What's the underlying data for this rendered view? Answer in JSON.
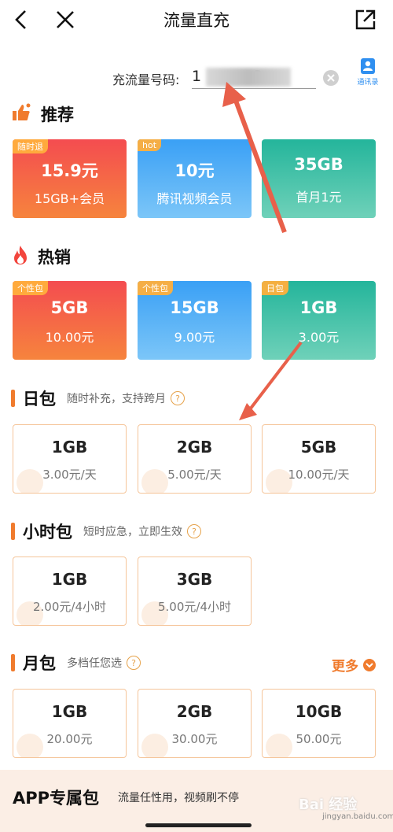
{
  "header": {
    "title": "流量直充"
  },
  "phone": {
    "label": "充流量号码:",
    "value": "1           3",
    "contacts_label": "通讯录"
  },
  "recommend": {
    "title": "推荐",
    "cards": [
      {
        "tag": "随时退",
        "main": "15.9元",
        "sub": "15GB+会员",
        "color": "red"
      },
      {
        "tag": "hot",
        "main": "10元",
        "sub": "腾讯视频会员",
        "color": "blue"
      },
      {
        "tag": "",
        "main": "35GB",
        "sub": "首月1元",
        "color": "teal"
      }
    ]
  },
  "hot": {
    "title": "热销",
    "cards": [
      {
        "tag": "个性包",
        "main": "5GB",
        "sub": "10.00元",
        "color": "red"
      },
      {
        "tag": "个性包",
        "main": "15GB",
        "sub": "9.00元",
        "color": "blue"
      },
      {
        "tag": "日包",
        "main": "1GB",
        "sub": "3.00元",
        "color": "teal"
      }
    ]
  },
  "daily": {
    "title": "日包",
    "subtitle": "随时补充，支持跨月",
    "cards": [
      {
        "main": "1GB",
        "sub": "3.00元/天"
      },
      {
        "main": "2GB",
        "sub": "5.00元/天"
      },
      {
        "main": "5GB",
        "sub": "10.00元/天"
      }
    ]
  },
  "hourly": {
    "title": "小时包",
    "subtitle": "短时应急，立即生效",
    "cards": [
      {
        "main": "1GB",
        "sub": "2.00元/4小时"
      },
      {
        "main": "3GB",
        "sub": "5.00元/4小时"
      }
    ]
  },
  "monthly": {
    "title": "月包",
    "subtitle": "多档任您选",
    "more": "更多",
    "cards": [
      {
        "main": "1GB",
        "sub": "20.00元"
      },
      {
        "main": "2GB",
        "sub": "30.00元"
      },
      {
        "main": "10GB",
        "sub": "50.00元"
      }
    ]
  },
  "app_pack": {
    "title": "APP专属包",
    "subtitle": "流量任性用，视频刷不停"
  },
  "help_mark": "?",
  "watermark": {
    "text": "Bai 经验",
    "url": "jingyan.baidu.com"
  },
  "colors": {
    "accent": "#f07b2d",
    "annotation_arrow": "#e8604a"
  }
}
